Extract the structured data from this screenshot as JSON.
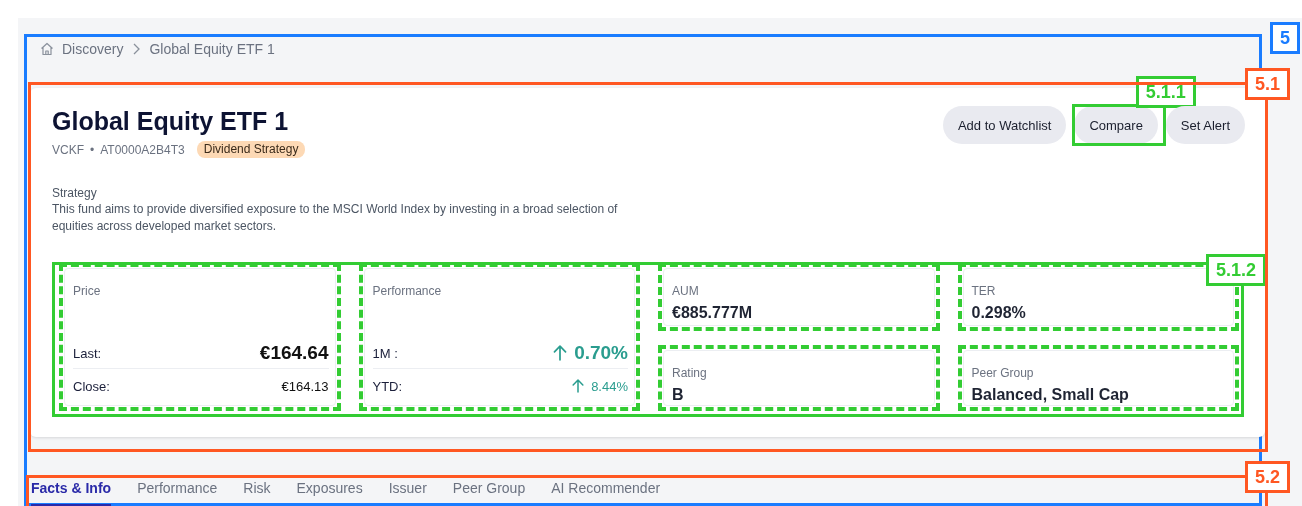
{
  "section": {
    "annotation": {
      "label": "5",
      "color": "#1a7cff"
    }
  },
  "breadcrumb": [
    {
      "label": "Discovery",
      "kind": "home"
    },
    {
      "label": "Global Equity ETF 1",
      "kind": "current"
    }
  ],
  "fund": {
    "annotation": {
      "label": "5.1",
      "color": "#ff5722"
    },
    "title": "Global Equity ETF 1",
    "ticker": "VCKF",
    "separator": "•",
    "isin": "AT0000A2B4T3",
    "tag": "Dividend Strategy",
    "actions": [
      {
        "label": "Add to Watchlist"
      },
      {
        "label": "Compare",
        "annotation": {
          "label": "5.1.1",
          "color": "#33cc33"
        }
      },
      {
        "label": "Set Alert"
      }
    ],
    "strategy": {
      "label": "Strategy",
      "text": "This fund aims to provide diversified exposure to the MSCI World Index by investing in a broad selection of equities across developed market sectors."
    },
    "metrics": {
      "annotation": {
        "label": "5.1.2",
        "color": "#33cc33"
      },
      "items": [
        {
          "kind": "rows",
          "label": "Price",
          "rows": [
            {
              "label": "Last:",
              "value": "€164.64",
              "emphasis": true
            },
            {
              "label": "Close:",
              "value": "€164.13",
              "emphasis": false
            }
          ]
        },
        {
          "kind": "rows",
          "label": "Performance",
          "rows": [
            {
              "label": "1M :",
              "value": "0.70%",
              "rising": true,
              "emphasis": true
            },
            {
              "label": "YTD:",
              "value": "8.44%",
              "rising": true,
              "emphasis": false
            }
          ]
        },
        {
          "kind": "stat",
          "label": "AUM",
          "value": "€885.777M"
        },
        {
          "kind": "stat",
          "label": "TER",
          "value": "0.298%"
        },
        {
          "kind": "stat",
          "label": "Rating",
          "value": "B"
        },
        {
          "kind": "stat",
          "label": "Peer Group",
          "value": "Balanced, Small Cap"
        }
      ]
    }
  },
  "tabs": {
    "annotation": {
      "label": "5.2",
      "color": "#ff5722"
    },
    "items": [
      {
        "label": "Facts & Info",
        "selected": true
      },
      {
        "label": "Performance",
        "selected": false
      },
      {
        "label": "Risk",
        "selected": false
      },
      {
        "label": "Exposures",
        "selected": false
      },
      {
        "label": "Issuer",
        "selected": false
      },
      {
        "label": "Peer Group",
        "selected": false
      },
      {
        "label": "AI Recommender",
        "selected": false
      }
    ]
  }
}
